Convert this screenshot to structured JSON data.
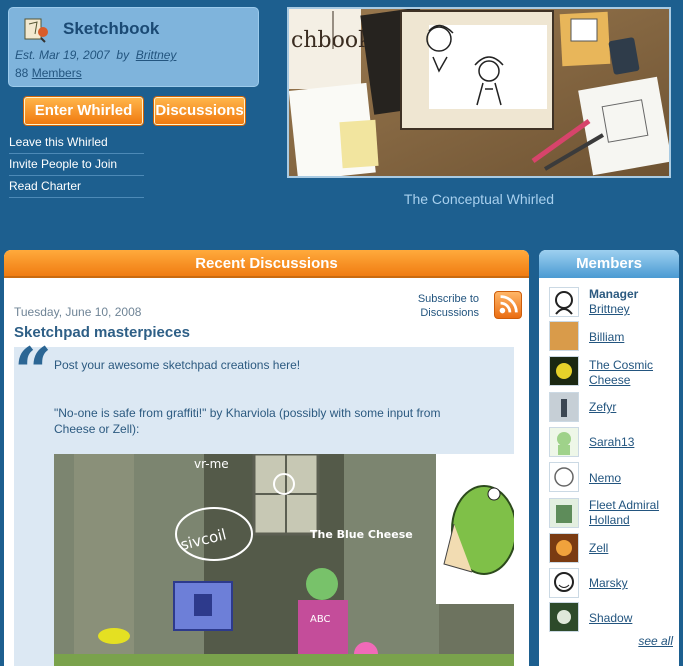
{
  "whirled": {
    "title": "Sketchbook",
    "established": "Est. Mar 19, 2007",
    "by_label": "by",
    "owner": "Brittney",
    "member_count": "88",
    "members_link": "Members"
  },
  "buttons": {
    "enter": "Enter Whirled",
    "discussions": "Discussions"
  },
  "side_links": [
    "Leave this Whirled",
    "Invite People to Join",
    "Read Charter"
  ],
  "banner": {
    "logo_text": "chbook",
    "caption": "The Conceptual Whirled"
  },
  "discussions": {
    "header": "Recent Discussions",
    "subscribe": "Subscribe to Discussions",
    "post": {
      "date": "Tuesday, June 10, 2008",
      "title": "Sketchpad masterpieces",
      "line1": "Post your awesome sketchpad creations here!",
      "line2": "\"No-one is safe from graffiti!\" by Kharviola (possibly with some input from Cheese or Zell):",
      "image_label": "The Blue Cheese",
      "image_scribble": "vr-me",
      "image_scribble2": "sivcoil",
      "image_tag": "ABC"
    }
  },
  "members": {
    "header": "Members",
    "list": [
      {
        "role": "Manager",
        "name": "Brittney"
      },
      {
        "role": "",
        "name": "Billiam"
      },
      {
        "role": "",
        "name": "The Cosmic Cheese"
      },
      {
        "role": "",
        "name": "Zefyr"
      },
      {
        "role": "",
        "name": "Sarah13"
      },
      {
        "role": "",
        "name": "Nemo"
      },
      {
        "role": "",
        "name": "Fleet Admiral Holland"
      },
      {
        "role": "",
        "name": "Zell"
      },
      {
        "role": "",
        "name": "Marsky"
      },
      {
        "role": "",
        "name": "Shadow"
      }
    ],
    "see_all": "see all"
  },
  "colors": {
    "page_bg": "#1d5f8f",
    "accent_orange": "#f07c12",
    "accent_blue": "#4a9ad2"
  }
}
